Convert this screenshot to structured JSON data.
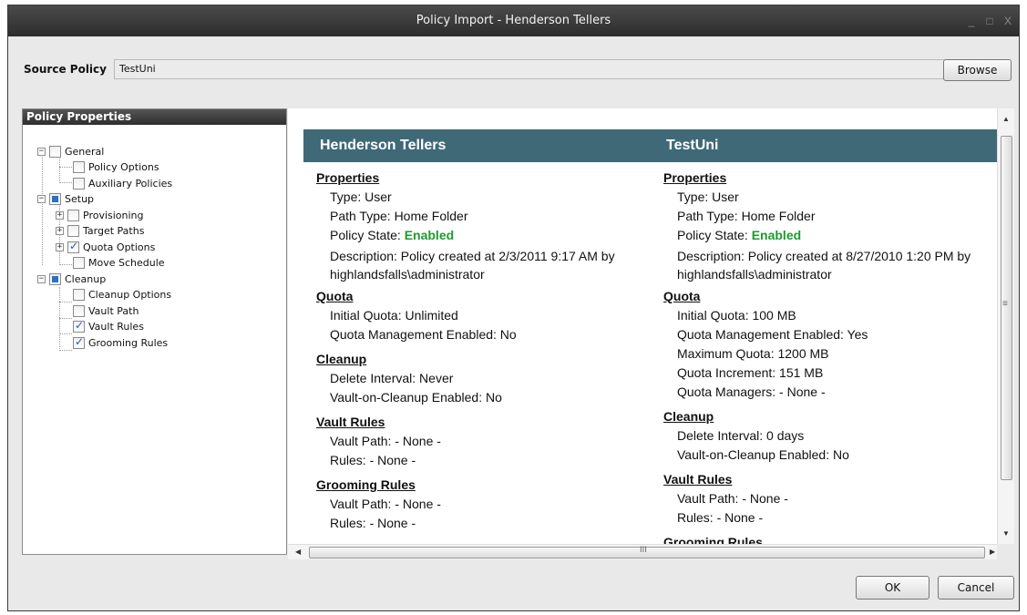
{
  "window": {
    "title": "Policy Import - Henderson Tellers",
    "controls": [
      "_",
      "□",
      "X"
    ]
  },
  "source": {
    "label": "Source Policy",
    "value": "TestUni",
    "browse_label": "Browse"
  },
  "left_panel": {
    "header": "Policy Properties",
    "tree": {
      "general": "General",
      "policy_options": "Policy Options",
      "auxiliary_policies": "Auxiliary Policies",
      "setup": "Setup",
      "provisioning": "Provisioning",
      "target_paths": "Target Paths",
      "quota_options": "Quota Options",
      "move_schedule": "Move Schedule",
      "cleanup": "Cleanup",
      "cleanup_options": "Cleanup Options",
      "vault_path": "Vault Path",
      "vault_rules": "Vault Rules",
      "grooming_rules": "Grooming Rules"
    }
  },
  "banner": {
    "left": "Henderson Tellers",
    "right": "TestUni"
  },
  "left_col": {
    "properties": "Properties",
    "type": "Type: User",
    "path_type": "Path Type: Home Folder",
    "policy_state_label": "Policy State: ",
    "policy_state_value": "Enabled",
    "description": "Description: Policy created at 2/3/2011 9:17 AM by highlandsfalls\\administrator",
    "quota": "Quota",
    "initial_quota": "Initial Quota: Unlimited",
    "quota_mgmt": "Quota Management Enabled: No",
    "cleanup": "Cleanup",
    "delete_interval": "Delete Interval: Never",
    "vault_on_cleanup": "Vault-on-Cleanup Enabled: No",
    "vault_rules": "Vault Rules",
    "vault_path": "Vault Path: - None -",
    "rules": "Rules: - None -",
    "grooming_rules": "Grooming Rules",
    "g_vault_path": "Vault Path: - None -",
    "g_rules": "Rules: - None -"
  },
  "right_col": {
    "properties": "Properties",
    "type": "Type: User",
    "path_type": "Path Type: Home Folder",
    "policy_state_label": "Policy State: ",
    "policy_state_value": "Enabled",
    "description": "Description: Policy created at 8/27/2010 1:20 PM by highlandsfalls\\administrator",
    "quota": "Quota",
    "initial_quota": "Initial Quota: 100 MB",
    "quota_mgmt": "Quota Management Enabled: Yes",
    "max_quota": "Maximum Quota: 1200 MB",
    "quota_increment": "Quota Increment: 151 MB",
    "quota_managers": "Quota Managers: - None -",
    "cleanup": "Cleanup",
    "delete_interval": "Delete Interval: 0 days",
    "vault_on_cleanup": "Vault-on-Cleanup Enabled: No",
    "vault_rules": "Vault Rules",
    "vault_path": "Vault Path: - None -",
    "rules": "Rules: - None -",
    "grooming_rules": "Grooming Rules"
  },
  "scroll": {
    "h_label": "III",
    "v_grip": "≡"
  },
  "buttons": {
    "ok": "OK",
    "cancel": "Cancel"
  },
  "colors": {
    "banner": "#3f6977",
    "enabled": "#1f9a2e",
    "titlebar": "#333333"
  }
}
